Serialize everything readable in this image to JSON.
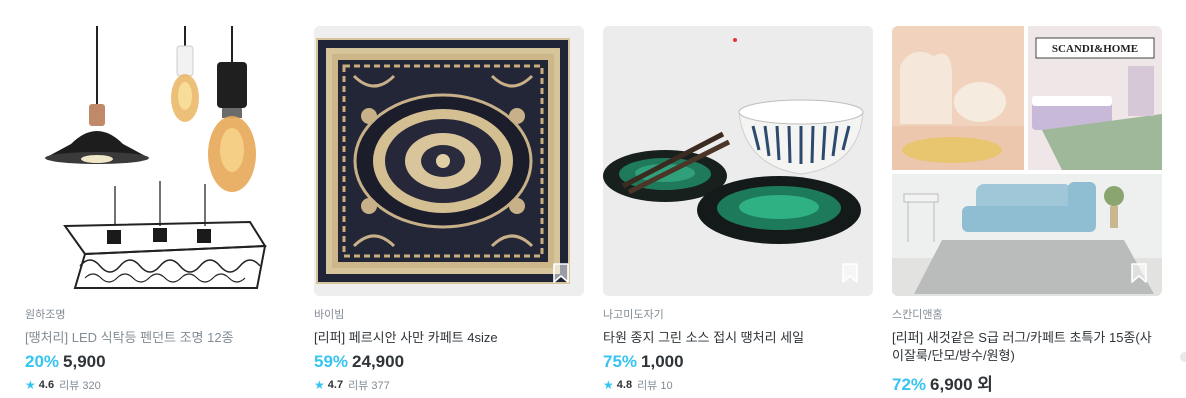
{
  "products": [
    {
      "brand": "원하조명",
      "title": "[땡처리] LED 식탁등 펜던트 조명 12종",
      "discount": "20%",
      "price": "5,900",
      "rating": "4.6",
      "review_label": "리뷰 320",
      "image_icon": "pendant-lamp-image"
    },
    {
      "brand": "바이빔",
      "title": "[리퍼] 페르시안 사만 카페트 4size",
      "discount": "59%",
      "price": "24,900",
      "rating": "4.7",
      "review_label": "리뷰 377",
      "image_icon": "persian-rug-image"
    },
    {
      "brand": "나고미도자기",
      "title": "타원 종지 그린 소스 접시 땡처리 세일",
      "discount": "75%",
      "price": "1,000",
      "rating": "4.8",
      "review_label": "리뷰 10",
      "image_icon": "ceramic-dishes-image"
    },
    {
      "brand": "스칸디앤홈",
      "title": "[리퍼] 새것같은 S급 러그/카페트 초특가 15종(사이잘룩/단모/방수/원형)",
      "discount": "72%",
      "price": "6,900 외",
      "image_icon": "rug-collage-image",
      "image_logo": "SCANDI&HOME"
    }
  ],
  "colors": {
    "accent": "#35c5f0",
    "text": "#2f3438",
    "muted": "#828c94"
  }
}
